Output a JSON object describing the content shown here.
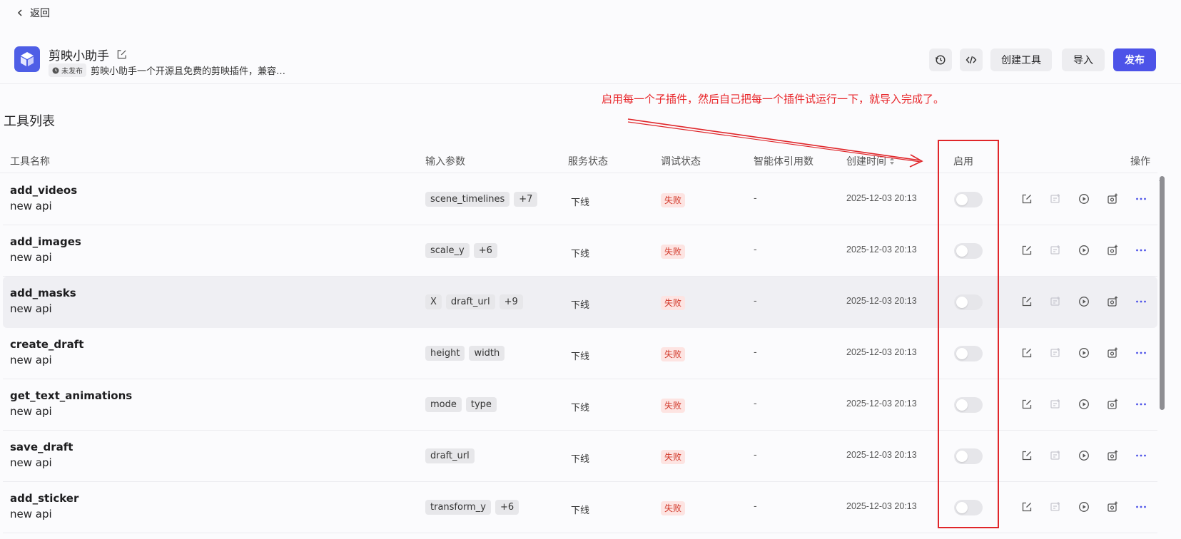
{
  "nav": {
    "back_label": "返回"
  },
  "plugin": {
    "title": "剪映小助手",
    "status_badge": "未发布",
    "description": "剪映小助手一个开源且免费的剪映插件，兼容…"
  },
  "header_buttons": {
    "history_icon": "history-icon",
    "code_icon": "code-icon",
    "create_tool": "创建工具",
    "import": "导入",
    "publish": "发布"
  },
  "annotation": "启用每一个子插件，然后自己把每一个插件试运行一下，就导入完成了。",
  "section_title": "工具列表",
  "columns": {
    "name": "工具名称",
    "params": "输入参数",
    "service_status": "服务状态",
    "debug_status": "调试状态",
    "agent_refs": "智能体引用数",
    "created_time": "创建时间",
    "enabled": "启用",
    "actions": "操作"
  },
  "rows": [
    {
      "name": "add_videos",
      "desc": "new api",
      "params": [
        "scene_timelines",
        "+7"
      ],
      "service": "下线",
      "debug": "失败",
      "refs": "-",
      "time": "2025-12-03 20:13",
      "enabled": false
    },
    {
      "name": "add_images",
      "desc": "new api",
      "params": [
        "scale_y",
        "+6"
      ],
      "service": "下线",
      "debug": "失败",
      "refs": "-",
      "time": "2025-12-03 20:13",
      "enabled": false
    },
    {
      "name": "add_masks",
      "desc": "new api",
      "params": [
        "X",
        "draft_url",
        "+9"
      ],
      "service": "下线",
      "debug": "失败",
      "refs": "-",
      "time": "2025-12-03 20:13",
      "enabled": false
    },
    {
      "name": "create_draft",
      "desc": "new api",
      "params": [
        "height",
        "width"
      ],
      "service": "下线",
      "debug": "失败",
      "refs": "-",
      "time": "2025-12-03 20:13",
      "enabled": false
    },
    {
      "name": "get_text_animations",
      "desc": "new api",
      "params": [
        "mode",
        "type"
      ],
      "service": "下线",
      "debug": "失败",
      "refs": "-",
      "time": "2025-12-03 20:13",
      "enabled": false
    },
    {
      "name": "save_draft",
      "desc": "new api",
      "params": [
        "draft_url"
      ],
      "service": "下线",
      "debug": "失败",
      "refs": "-",
      "time": "2025-12-03 20:13",
      "enabled": false
    },
    {
      "name": "add_sticker",
      "desc": "new api",
      "params": [
        "transform_y",
        "+6"
      ],
      "service": "下线",
      "debug": "失败",
      "refs": "-",
      "time": "2025-12-03 20:13",
      "enabled": false
    }
  ],
  "row_actions": [
    "edit-icon",
    "copy-icon",
    "run-icon",
    "debug-icon",
    "more-icon"
  ],
  "colors": {
    "primary": "#4d53e8",
    "annotation_red": "#e0262a",
    "fail_bg": "#fde4e2",
    "fail_text": "#d23a2c"
  }
}
